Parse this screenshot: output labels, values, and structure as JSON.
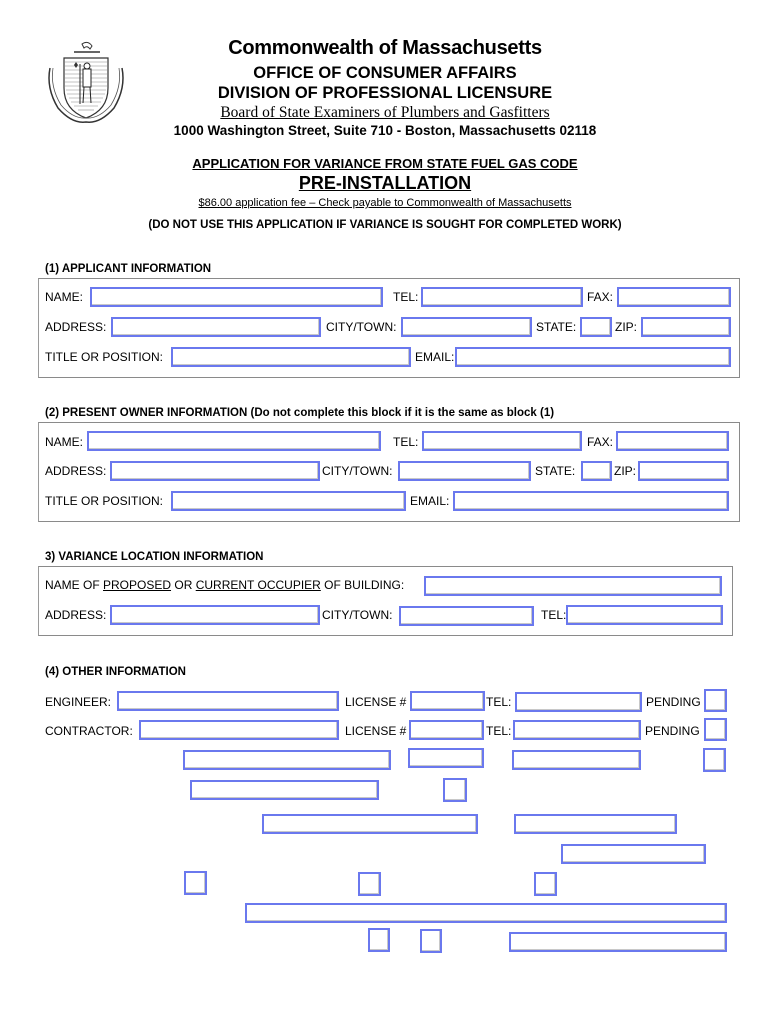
{
  "header": {
    "title": "Commonwealth of Massachusetts",
    "office": "OFFICE OF CONSUMER AFFAIRS",
    "division": "DIVISION OF PROFESSIONAL LICENSURE",
    "board": "Board of State Examiners of Plumbers and Gasfitters",
    "address": "1000 Washington Street, Suite 710 - Boston, Massachusetts 02118",
    "application_title": "APPLICATION FOR VARIANCE FROM STATE FUEL GAS CODE",
    "subtitle": "PRE-INSTALLATION",
    "fee_note": "$86.00 application fee – Check payable to Commonwealth of Massachusetts",
    "warning": "(DO NOT USE THIS APPLICATION IF VARIANCE IS SOUGHT FOR COMPLETED WORK)",
    "seal_icon": "massachusetts-state-seal"
  },
  "applicant": {
    "title": "(1) APPLICANT INFORMATION",
    "labels": {
      "name": "NAME:",
      "tel": "TEL:",
      "fax": "FAX:",
      "address": "ADDRESS:",
      "city": "CITY/TOWN:",
      "state": "STATE:",
      "zip": "ZIP:",
      "title_position": "TITLE OR POSITION:",
      "email": "EMAIL:"
    },
    "values": {
      "name": "",
      "tel": "",
      "fax": "",
      "address": "",
      "city": "",
      "state": "",
      "zip": "",
      "title_position": "",
      "email": ""
    }
  },
  "owner": {
    "title": "(2) PRESENT OWNER INFORMATION (Do not complete this block if it is the same as block (1)",
    "labels": {
      "name": "NAME:",
      "tel": "TEL:",
      "fax": "FAX:",
      "address": "ADDRESS:",
      "city": "CITY/TOWN:",
      "state": "STATE:",
      "zip": "ZIP:",
      "title_position": "TITLE OR POSITION:",
      "email": "EMAIL:"
    },
    "values": {
      "name": "",
      "tel": "",
      "fax": "",
      "address": "",
      "city": "",
      "state": "",
      "zip": "",
      "title_position": "",
      "email": ""
    }
  },
  "location": {
    "title": "3) VARIANCE LOCATION INFORMATION",
    "occupier_label_parts": [
      "NAME OF ",
      "PROPOSED",
      " OR ",
      "CURRENT OCCUPIER",
      " OF BUILDING:"
    ],
    "labels": {
      "address": "ADDRESS:",
      "city": "CITY/TOWN:",
      "tel": "TEL:"
    },
    "values": {
      "occupier": "",
      "address": "",
      "city": "",
      "tel": ""
    }
  },
  "other": {
    "title": "(4) OTHER INFORMATION",
    "labels": {
      "engineer": "ENGINEER:",
      "contractor": "CONTRACTOR:",
      "license": "LICENSE #",
      "tel": "TEL:",
      "pending": "PENDING"
    },
    "values": {
      "engineer": "",
      "engineer_license": "",
      "engineer_tel": "",
      "engineer_pending": false,
      "contractor": "",
      "contractor_license": "",
      "contractor_tel": "",
      "contractor_pending": false
    }
  }
}
